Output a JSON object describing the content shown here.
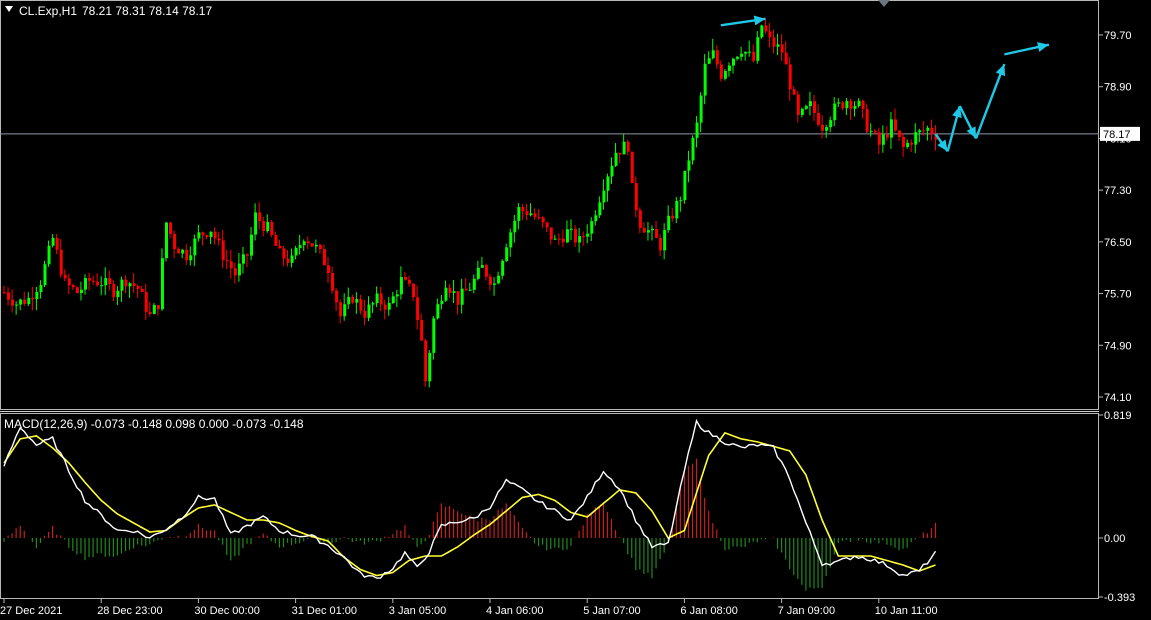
{
  "header": {
    "symbol": "CL.Exp,H1",
    "ohlc": "78.21 78.31 78.14 78.17"
  },
  "macd_header": {
    "label": "MACD(12,26,9) -0.073 -0.148 0.098 0.000 -0.073 -0.148"
  },
  "current_price_label": "78.17",
  "colors": {
    "background": "#000000",
    "bull": "#00ff00",
    "bear": "#ff0000",
    "hist_pos": "#c81e1e",
    "hist_neg": "#1f8a1f",
    "macd_line": "#ffffff",
    "signal_line": "#ffff33",
    "arrows": "#1ec8e6",
    "price_line": "#8c9aa8"
  },
  "chart_data": [
    {
      "type": "candlestick",
      "title": "CL.Exp,H1",
      "xlabel": "",
      "ylabel": "",
      "ylim": [
        73.93,
        80.21
      ],
      "current_price": 78.17,
      "y_ticks": [
        "79.70",
        "78.90",
        "78.10",
        "77.30",
        "76.50",
        "75.70",
        "74.90",
        "74.10"
      ],
      "x_ticks": [
        {
          "label": "27 Dec 2021",
          "index": 0
        },
        {
          "label": "28 Dec 23:00",
          "index": 24
        },
        {
          "label": "30 Dec 00:00",
          "index": 48
        },
        {
          "label": "31 Dec 01:00",
          "index": 72
        },
        {
          "label": "3 Jan 05:00",
          "index": 96
        },
        {
          "label": "4 Jan 06:00",
          "index": 120
        },
        {
          "label": "5 Jan 07:00",
          "index": 144
        },
        {
          "label": "6 Jan 08:00",
          "index": 168
        },
        {
          "label": "7 Jan 09:00",
          "index": 192
        },
        {
          "label": "10 Jan 11:00",
          "index": 216
        }
      ],
      "close_anchors": [
        [
          0,
          75.72
        ],
        [
          3,
          75.55
        ],
        [
          6,
          75.62
        ],
        [
          9,
          75.9
        ],
        [
          12,
          76.55
        ],
        [
          15,
          75.85
        ],
        [
          18,
          75.72
        ],
        [
          21,
          75.9
        ],
        [
          24,
          75.88
        ],
        [
          27,
          75.75
        ],
        [
          30,
          75.92
        ],
        [
          33,
          75.78
        ],
        [
          36,
          75.35
        ],
        [
          38,
          75.55
        ],
        [
          40,
          76.8
        ],
        [
          42,
          76.45
        ],
        [
          45,
          76.3
        ],
        [
          48,
          76.6
        ],
        [
          51,
          76.7
        ],
        [
          54,
          76.3
        ],
        [
          57,
          76.0
        ],
        [
          60,
          76.3
        ],
        [
          62,
          76.9
        ],
        [
          65,
          76.7
        ],
        [
          68,
          76.3
        ],
        [
          71,
          76.2
        ],
        [
          74,
          76.6
        ],
        [
          77,
          76.4
        ],
        [
          80,
          76.1
        ],
        [
          83,
          75.35
        ],
        [
          86,
          75.65
        ],
        [
          89,
          75.4
        ],
        [
          92,
          75.6
        ],
        [
          95,
          75.5
        ],
        [
          98,
          75.9
        ],
        [
          101,
          75.7
        ],
        [
          103,
          74.95
        ],
        [
          104,
          74.35
        ],
        [
          106,
          75.3
        ],
        [
          109,
          75.9
        ],
        [
          112,
          75.6
        ],
        [
          115,
          75.8
        ],
        [
          118,
          76.1
        ],
        [
          121,
          75.85
        ],
        [
          124,
          76.5
        ],
        [
          127,
          77.0
        ],
        [
          130,
          76.95
        ],
        [
          133,
          76.75
        ],
        [
          136,
          76.5
        ],
        [
          139,
          76.65
        ],
        [
          142,
          76.5
        ],
        [
          145,
          76.8
        ],
        [
          148,
          77.4
        ],
        [
          151,
          77.9
        ],
        [
          154,
          78.0
        ],
        [
          155,
          77.3
        ],
        [
          157,
          76.8
        ],
        [
          160,
          76.6
        ],
        [
          162,
          76.45
        ],
        [
          164,
          76.8
        ],
        [
          167,
          77.2
        ],
        [
          169,
          77.8
        ],
        [
          171,
          78.3
        ],
        [
          173,
          79.2
        ],
        [
          175,
          79.4
        ],
        [
          177,
          79.1
        ],
        [
          179,
          79.3
        ],
        [
          182,
          79.5
        ],
        [
          185,
          79.3
        ],
        [
          187,
          79.85
        ],
        [
          189,
          79.6
        ],
        [
          192,
          79.45
        ],
        [
          194,
          78.95
        ],
        [
          196,
          78.4
        ],
        [
          199,
          78.6
        ],
        [
          202,
          78.3
        ],
        [
          205,
          78.55
        ],
        [
          208,
          78.7
        ],
        [
          211,
          78.6
        ],
        [
          213,
          78.3
        ],
        [
          216,
          78.0
        ],
        [
          219,
          78.3
        ],
        [
          222,
          77.95
        ],
        [
          225,
          78.15
        ],
        [
          228,
          78.25
        ],
        [
          230,
          78.17
        ]
      ],
      "projection_arrows": [
        [
          [
            230,
            78.17
          ],
          [
            233,
            77.9
          ]
        ],
        [
          [
            233,
            77.9
          ],
          [
            236,
            78.6
          ]
        ],
        [
          [
            236,
            78.6
          ],
          [
            240,
            78.1
          ]
        ],
        [
          [
            240,
            78.1
          ],
          [
            247,
            79.25
          ]
        ],
        [
          [
            247,
            79.4
          ],
          [
            258,
            79.55
          ]
        ],
        [
          [
            177,
            79.85
          ],
          [
            188,
            79.95
          ]
        ]
      ]
    },
    {
      "type": "macd",
      "title": "MACD(12,26,9)",
      "params": [
        12,
        26,
        9
      ],
      "ylim": [
        -0.393,
        0.819
      ],
      "y_ticks": [
        "0.819",
        "0.00",
        "-0.393"
      ],
      "values": [
        -0.073,
        -0.148,
        0.098,
        0.0,
        -0.073,
        -0.148
      ],
      "macd_anchors": [
        [
          0,
          0.48
        ],
        [
          4,
          0.74
        ],
        [
          8,
          0.62
        ],
        [
          12,
          0.66
        ],
        [
          16,
          0.45
        ],
        [
          20,
          0.25
        ],
        [
          24,
          0.15
        ],
        [
          28,
          0.05
        ],
        [
          32,
          0.05
        ],
        [
          36,
          0.0
        ],
        [
          40,
          0.06
        ],
        [
          44,
          0.14
        ],
        [
          48,
          0.27
        ],
        [
          52,
          0.26
        ],
        [
          56,
          0.02
        ],
        [
          60,
          0.08
        ],
        [
          64,
          0.14
        ],
        [
          68,
          0.05
        ],
        [
          72,
          0.02
        ],
        [
          76,
          0.01
        ],
        [
          80,
          -0.05
        ],
        [
          84,
          -0.13
        ],
        [
          88,
          -0.24
        ],
        [
          92,
          -0.27
        ],
        [
          96,
          -0.2
        ],
        [
          99,
          -0.1
        ],
        [
          102,
          -0.2
        ],
        [
          105,
          -0.09
        ],
        [
          108,
          0.08
        ],
        [
          112,
          0.11
        ],
        [
          116,
          0.13
        ],
        [
          120,
          0.21
        ],
        [
          124,
          0.38
        ],
        [
          128,
          0.32
        ],
        [
          132,
          0.24
        ],
        [
          136,
          0.18
        ],
        [
          140,
          0.12
        ],
        [
          144,
          0.27
        ],
        [
          148,
          0.45
        ],
        [
          152,
          0.33
        ],
        [
          156,
          0.12
        ],
        [
          160,
          -0.06
        ],
        [
          164,
          -0.04
        ],
        [
          168,
          0.45
        ],
        [
          171,
          0.77
        ],
        [
          174,
          0.7
        ],
        [
          178,
          0.64
        ],
        [
          182,
          0.6
        ],
        [
          186,
          0.62
        ],
        [
          190,
          0.6
        ],
        [
          194,
          0.4
        ],
        [
          198,
          0.1
        ],
        [
          202,
          -0.17
        ],
        [
          206,
          -0.16
        ],
        [
          210,
          -0.12
        ],
        [
          214,
          -0.14
        ],
        [
          218,
          -0.18
        ],
        [
          222,
          -0.25
        ],
        [
          226,
          -0.22
        ],
        [
          230,
          -0.1
        ]
      ],
      "signal_anchors": [
        [
          0,
          0.5
        ],
        [
          4,
          0.66
        ],
        [
          8,
          0.68
        ],
        [
          12,
          0.6
        ],
        [
          16,
          0.5
        ],
        [
          20,
          0.37
        ],
        [
          24,
          0.25
        ],
        [
          28,
          0.16
        ],
        [
          32,
          0.1
        ],
        [
          36,
          0.04
        ],
        [
          40,
          0.05
        ],
        [
          44,
          0.13
        ],
        [
          48,
          0.2
        ],
        [
          52,
          0.22
        ],
        [
          56,
          0.17
        ],
        [
          60,
          0.12
        ],
        [
          64,
          0.12
        ],
        [
          68,
          0.1
        ],
        [
          72,
          0.05
        ],
        [
          76,
          0.01
        ],
        [
          80,
          -0.02
        ],
        [
          84,
          -0.13
        ],
        [
          88,
          -0.21
        ],
        [
          92,
          -0.25
        ],
        [
          96,
          -0.23
        ],
        [
          100,
          -0.15
        ],
        [
          104,
          -0.12
        ],
        [
          108,
          -0.12
        ],
        [
          112,
          -0.06
        ],
        [
          116,
          0.02
        ],
        [
          120,
          0.09
        ],
        [
          124,
          0.18
        ],
        [
          128,
          0.27
        ],
        [
          132,
          0.29
        ],
        [
          136,
          0.25
        ],
        [
          140,
          0.17
        ],
        [
          144,
          0.14
        ],
        [
          148,
          0.23
        ],
        [
          152,
          0.32
        ],
        [
          156,
          0.3
        ],
        [
          160,
          0.18
        ],
        [
          164,
          0.0
        ],
        [
          168,
          0.05
        ],
        [
          171,
          0.3
        ],
        [
          174,
          0.55
        ],
        [
          178,
          0.7
        ],
        [
          182,
          0.66
        ],
        [
          186,
          0.64
        ],
        [
          190,
          0.61
        ],
        [
          194,
          0.58
        ],
        [
          198,
          0.42
        ],
        [
          202,
          0.12
        ],
        [
          206,
          -0.12
        ],
        [
          210,
          -0.12
        ],
        [
          214,
          -0.12
        ],
        [
          218,
          -0.15
        ],
        [
          222,
          -0.18
        ],
        [
          226,
          -0.22
        ],
        [
          230,
          -0.18
        ]
      ]
    }
  ]
}
